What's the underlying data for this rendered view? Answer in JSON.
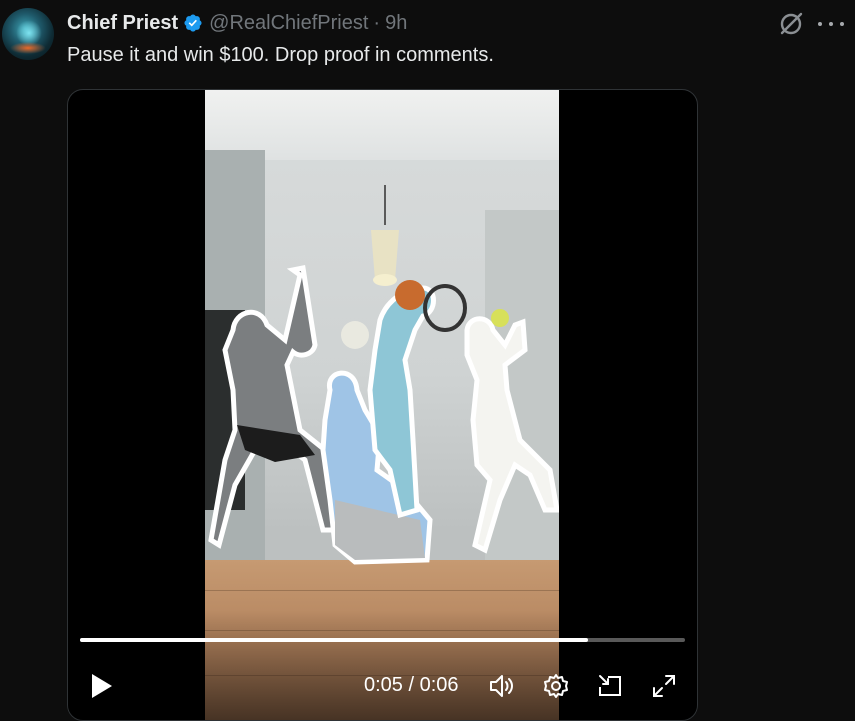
{
  "post": {
    "author_name": "Chief Priest",
    "handle": "@RealChiefPriest",
    "separator": "·",
    "time": "9h",
    "text": "Pause it and win $100. Drop proof in comments."
  },
  "icons": {
    "verified": "verified-badge-icon",
    "grok": "grok-icon",
    "more": "more-options-icon",
    "play": "play-icon",
    "volume": "volume-icon",
    "settings": "settings-gear-icon",
    "pip": "picture-in-picture-icon",
    "fullscreen": "fullscreen-icon"
  },
  "video": {
    "current_time": "0:05",
    "duration": "0:06",
    "time_label": "0:05 / 0:06",
    "progress": 0.84
  },
  "colors": {
    "background": "#0d0d0d",
    "verified_blue": "#1d9bf0",
    "secondary_text": "#71767b",
    "primary_text": "#e7e9ea"
  }
}
